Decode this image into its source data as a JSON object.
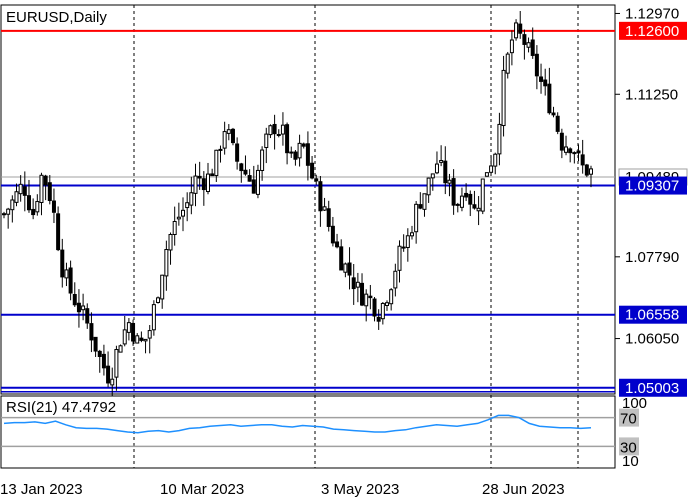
{
  "chart_data": {
    "type": "candlestick",
    "title": "EURUSD,Daily",
    "symbol": "EURUSD",
    "timeframe": "Daily",
    "price_ticks": [
      "1.12970",
      "1.11250",
      "1.07790",
      "1.06050"
    ],
    "price_range": [
      1.0487,
      1.1315
    ],
    "current_price": "1.09489",
    "x_tick_labels": [
      "13 Jan 2023",
      "10 Mar 2023",
      "3 May 2023",
      "28 Jun 2023"
    ],
    "levels": [
      {
        "label": "1.12600",
        "value": 1.126,
        "color": "#ff0000"
      },
      {
        "label": "1.09307",
        "value": 1.09307,
        "color": "#0000cc"
      },
      {
        "label": "1.06558",
        "value": 1.06558,
        "color": "#0000cc"
      },
      {
        "label": "1.05003",
        "value": 1.05003,
        "color": "#0000cc"
      }
    ],
    "candles_approx": {
      "count": 142,
      "close_path": [
        1.087,
        1.09,
        1.0935,
        1.087,
        1.096,
        1.0895,
        1.076,
        1.07,
        1.0665,
        1.062,
        1.056,
        1.052,
        1.06,
        1.064,
        1.059,
        1.061,
        1.071,
        1.081,
        1.086,
        1.089,
        1.095,
        1.094,
        1.098,
        1.106,
        1.099,
        1.096,
        1.093,
        1.101,
        1.106,
        1.104,
        1.097,
        1.102,
        1.095,
        1.089,
        1.083,
        1.0775,
        1.074,
        1.07,
        1.069,
        1.066,
        1.071,
        1.078,
        1.082,
        1.089,
        1.093,
        1.098,
        1.094,
        1.089,
        1.093,
        1.087,
        1.096,
        1.1,
        1.117,
        1.126,
        1.124,
        1.119,
        1.114,
        1.109,
        1.102,
        1.102,
        1.097,
        1.096
      ],
      "note": ""
    },
    "indicator": {
      "name": "RSI(21)",
      "value": "47.4792",
      "levels": [
        "70",
        "30"
      ],
      "scale_ticks": [
        "100",
        "10"
      ],
      "values": [
        62,
        63,
        63,
        64,
        62,
        65,
        60,
        56,
        55,
        55,
        54,
        52,
        50,
        49,
        51,
        52,
        50,
        52,
        55,
        56,
        58,
        59,
        60,
        58,
        59,
        60,
        60,
        58,
        57,
        59,
        58,
        57,
        54,
        53,
        52,
        51,
        50,
        50,
        52,
        53,
        56,
        58,
        60,
        59,
        58,
        60,
        62,
        67,
        73,
        73,
        70,
        62,
        58,
        57,
        56,
        56,
        55,
        56
      ],
      "ylim": [
        0,
        100
      ]
    }
  },
  "colors": {
    "candle": "#000000",
    "rsi_line": "#1e90ff",
    "grid": "#000000",
    "rsi_level_line": "#a0a0a0",
    "current_price_line": "#a0a0a0"
  }
}
